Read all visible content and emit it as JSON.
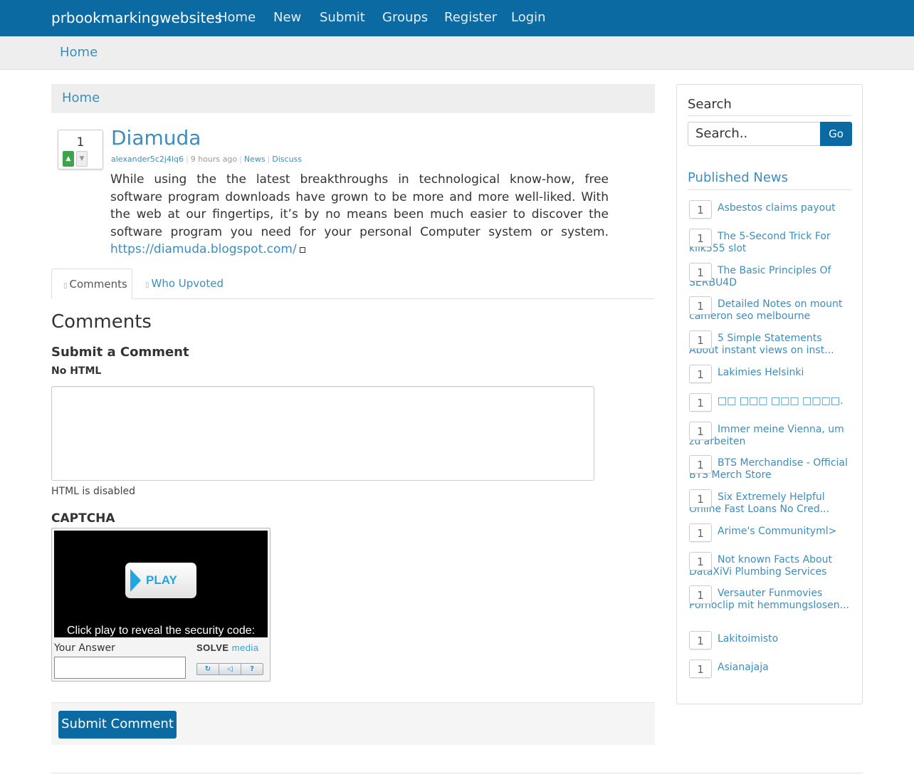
{
  "navbar": {
    "brand": "prbookmarkingwebsites",
    "items": [
      "Home",
      "New",
      "Submit",
      "Groups",
      "Register",
      "Login"
    ]
  },
  "breadcrumb": {
    "top": "Home",
    "inner": "Home"
  },
  "post": {
    "votes": "1",
    "upvote_icon": "thumbs-up-icon",
    "downvote_icon": "thumbs-down-icon",
    "title": "Diamuda",
    "author": "alexander5c2j4lq6",
    "time": "9 hours ago",
    "category": "News",
    "discuss": "Discuss",
    "body": "While using the the latest breakthroughs in technological know-how, free software program downloads have grown to be more and more well-liked. With the web at our fingertips, it’s by no means been much easier to discover the software program you need for your personal Computer system or system.",
    "link": "https://diamuda.blogspot.com/"
  },
  "tabs": {
    "comments": "Comments",
    "who_upvoted": "Who Upvoted"
  },
  "comments": {
    "heading": "Comments",
    "submit_heading": "Submit a Comment",
    "no_html": "No HTML",
    "html_disabled": "HTML is disabled",
    "captcha_title": "CAPTCHA",
    "captcha_play": "PLAY",
    "captcha_text": "Click play to reveal the security code:",
    "your_answer": "Your Answer",
    "solve_logo_a": "SOLVE",
    "solve_logo_b": "media",
    "submit_button": "Submit Comment"
  },
  "sidebar": {
    "search_heading": "Search",
    "search_placeholder": "Search..",
    "go": "Go",
    "published_heading": "Published News",
    "news": [
      {
        "count": "1",
        "title": "Asbestos claims payout"
      },
      {
        "count": "1",
        "title": "The 5-Second Trick For klik555 slot"
      },
      {
        "count": "1",
        "title": "The Basic Principles Of SERBU4D"
      },
      {
        "count": "1",
        "title": "Detailed Notes on mount cameron seo melbourne"
      },
      {
        "count": "1",
        "title": "5 Simple Statements About instant views on inst..."
      },
      {
        "count": "1",
        "title": "Lakimies Helsinki"
      },
      {
        "count": "1",
        "title": "□□ □□□ □□□ □□□□."
      },
      {
        "count": "1",
        "title": "Immer meine Vienna, um zu arbeiten"
      },
      {
        "count": "1",
        "title": "BTS Merchandise - Official BTS Merch Store"
      },
      {
        "count": "1",
        "title": "Six Extremely Helpful Online Fast Loans No Cred..."
      },
      {
        "count": "1",
        "title": "Arime's Communityml>"
      },
      {
        "count": "1",
        "title": "Not known Facts About DataXiVi Plumbing Services"
      },
      {
        "count": "1",
        "title": "Versauter Funmovies Pornoclip mit hemmungslosen..."
      },
      {
        "count": "1",
        "title": "Lakitoimisto"
      },
      {
        "count": "1",
        "title": "Asianajaja"
      }
    ]
  }
}
